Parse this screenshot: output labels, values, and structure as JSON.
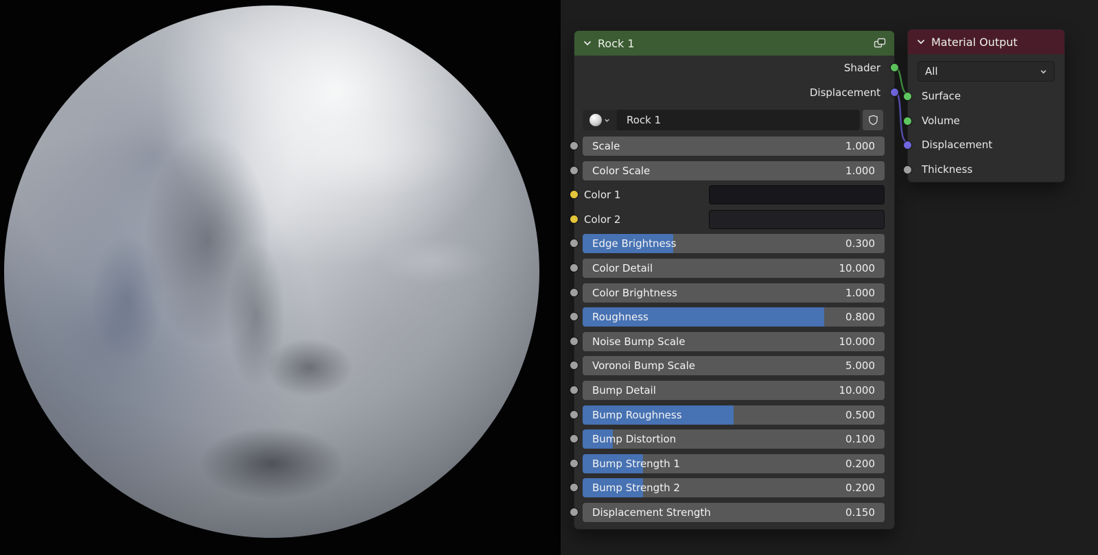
{
  "colors": {
    "editor_bg": "#1d1d1d",
    "node_body": "#2d2d2d",
    "rock_header": "#3c5c33",
    "output_header": "#4a1c2a",
    "slider_track": "#585858",
    "slider_fill": "#4772b3",
    "socket_gray": "#a0a0a0",
    "socket_green": "#5fc75f",
    "socket_vector": "#7066de",
    "socket_yellow": "#e2c53a"
  },
  "rock_node": {
    "title": "Rock 1",
    "outputs": [
      {
        "label": "Shader",
        "socket": "#5fc75f"
      },
      {
        "label": "Displacement",
        "socket": "#7066de"
      }
    ],
    "material": {
      "name": "Rock 1"
    },
    "inputs": [
      {
        "type": "slider",
        "label": "Scale",
        "value": "1.000",
        "fill": 0,
        "socket": "#a0a0a0"
      },
      {
        "type": "slider",
        "label": "Color Scale",
        "value": "1.000",
        "fill": 0,
        "socket": "#a0a0a0"
      },
      {
        "type": "color",
        "label": "Color 1",
        "swatch": "#17171c",
        "socket": "#e2c53a"
      },
      {
        "type": "color",
        "label": "Color 2",
        "swatch": "#202024",
        "socket": "#e2c53a"
      },
      {
        "type": "slider",
        "label": "Edge Brightness",
        "value": "0.300",
        "fill": 0.3,
        "socket": "#a0a0a0"
      },
      {
        "type": "slider",
        "label": "Color Detail",
        "value": "10.000",
        "fill": 0,
        "socket": "#a0a0a0"
      },
      {
        "type": "slider",
        "label": "Color Brightness",
        "value": "1.000",
        "fill": 0,
        "socket": "#a0a0a0"
      },
      {
        "type": "slider",
        "label": "Roughness",
        "value": "0.800",
        "fill": 0.8,
        "socket": "#a0a0a0"
      },
      {
        "type": "slider",
        "label": "Noise Bump Scale",
        "value": "10.000",
        "fill": 0,
        "socket": "#a0a0a0"
      },
      {
        "type": "slider",
        "label": "Voronoi Bump Scale",
        "value": "5.000",
        "fill": 0,
        "socket": "#a0a0a0"
      },
      {
        "type": "slider",
        "label": "Bump Detail",
        "value": "10.000",
        "fill": 0,
        "socket": "#a0a0a0"
      },
      {
        "type": "slider",
        "label": "Bump Roughness",
        "value": "0.500",
        "fill": 0.5,
        "socket": "#a0a0a0"
      },
      {
        "type": "slider",
        "label": "Bump Distortion",
        "value": "0.100",
        "fill": 0.1,
        "socket": "#a0a0a0"
      },
      {
        "type": "slider",
        "label": "Bump Strength 1",
        "value": "0.200",
        "fill": 0.2,
        "socket": "#a0a0a0"
      },
      {
        "type": "slider",
        "label": "Bump Strength 2",
        "value": "0.200",
        "fill": 0.2,
        "socket": "#a0a0a0"
      },
      {
        "type": "slider",
        "label": "Displacement Strength",
        "value": "0.150",
        "fill": 0,
        "socket": "#a0a0a0"
      }
    ]
  },
  "output_node": {
    "title": "Material Output",
    "target": "All",
    "inputs": [
      {
        "label": "Surface",
        "socket": "#5fc75f"
      },
      {
        "label": "Volume",
        "socket": "#5fc75f"
      },
      {
        "label": "Displacement",
        "socket": "#7066de"
      },
      {
        "label": "Thickness",
        "socket": "#a0a0a0"
      }
    ]
  },
  "connections": [
    {
      "from": "Shader",
      "to": "Surface",
      "color": "#4ea74e"
    },
    {
      "from": "Displacement",
      "to": "Displacement",
      "color": "#6a5fd6"
    }
  ]
}
